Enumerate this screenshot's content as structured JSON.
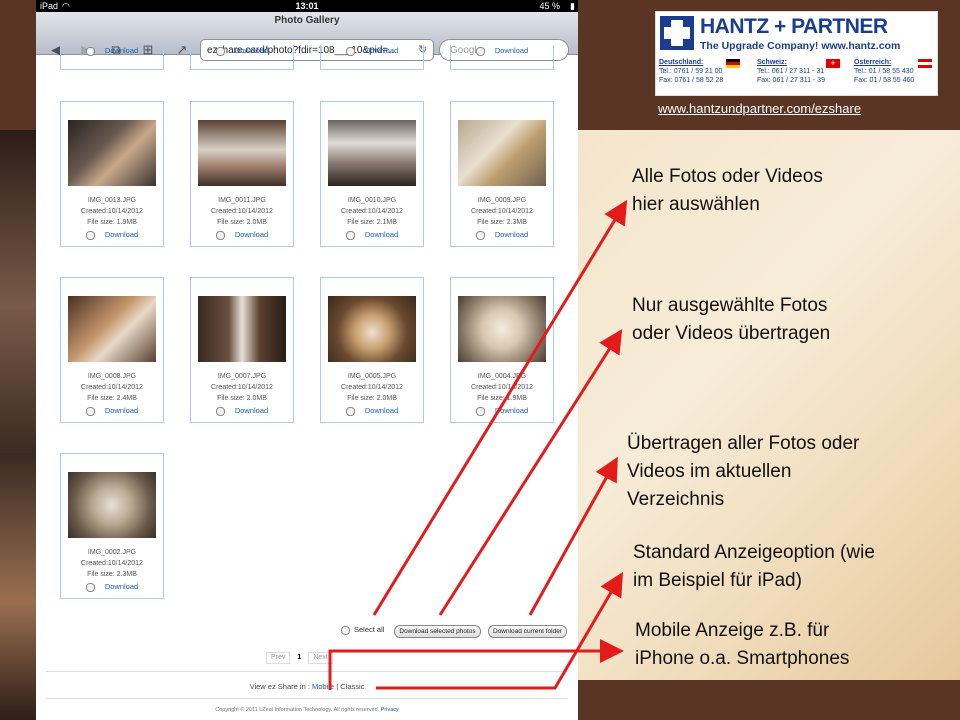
{
  "status": {
    "device": "iPad",
    "time": "13:01",
    "battery": "45 %"
  },
  "browser": {
    "page_title": "Photo Gallery",
    "url": "ezshare.card/photo?fdir=108___10&pid=...",
    "search_placeholder": "Google"
  },
  "gallery": {
    "download_label": "Download",
    "photos": [
      {
        "name": "IMG_0013.JPG",
        "created": "Created:10/14/2012",
        "size": "File size:   1.9MB"
      },
      {
        "name": "IMG_0011.JPG",
        "created": "Created:10/14/2012",
        "size": "File size:   2.0MB"
      },
      {
        "name": "IMG_0010.JPG",
        "created": "Created:10/14/2012",
        "size": "File size:   2.1MB"
      },
      {
        "name": "IMG_0009.JPG",
        "created": "Created:10/14/2012",
        "size": "File size:   2.3MB"
      },
      {
        "name": "IMG_0008.JPG",
        "created": "Created:10/14/2012",
        "size": "File size:   2.4MB"
      },
      {
        "name": "IMG_0007.JPG",
        "created": "Created:10/14/2012",
        "size": "File size:   2.0MB"
      },
      {
        "name": "IMG_0005.JPG",
        "created": "Created:10/14/2012",
        "size": "File size:   2.0MB"
      },
      {
        "name": "IMG_0004.JPG",
        "created": "Created:10/14/2012",
        "size": "File size:   1.9MB"
      },
      {
        "name": "IMG_0002.JPG",
        "created": "Created:10/14/2012",
        "size": "File size:   2.3MB"
      }
    ],
    "select_all": "Select all",
    "download_selected": "Download selected photos",
    "download_folder": "Download current folder",
    "pager": {
      "prev": "Prev",
      "current": "1",
      "next": "Next"
    },
    "view_in": "View ez Share in :",
    "mobile": "Mobile",
    "separator": "|",
    "classic": "Classic",
    "copyright": "Copyright © 2011 LZeal Information Technology. All rights reserved.",
    "privacy": "Privacy"
  },
  "logo": {
    "name": "HANTZ + PARTNER",
    "tagline": "The Upgrade Company! www.hantz.com",
    "columns": [
      {
        "country": "Deutschland:",
        "tel": "Tel.: 0761 / 59 21 00",
        "fax": "Fax: 0761 / 58 52 28"
      },
      {
        "country": "Schweiz:",
        "tel": "Tel.: 061 / 27 311 - 31",
        "fax": "Fax: 061 / 27 311 - 39"
      },
      {
        "country": "Österreich:",
        "tel": "Tel.: 01 / 58 55 430",
        "fax": "Fax: 01 / 58 55 460"
      }
    ]
  },
  "weblink": "www.hantzundpartner.com/ezshare",
  "annotations": [
    {
      "line1": "Alle Fotos oder Videos",
      "line2": "hier auswählen"
    },
    {
      "line1": "Nur ausgewählte Fotos",
      "line2": "oder Videos übertragen"
    },
    {
      "line1": "Übertragen aller Fotos oder",
      "line2": "Videos im aktuellen",
      "line3": "Verzeichnis"
    },
    {
      "line1": "Standard Anzeigeoption (wie",
      "line2": "im Beispiel für iPad)"
    },
    {
      "line1": "Mobile Anzeige z.B. für",
      "line2": "iPhone o.a. Smartphones"
    }
  ],
  "colors": {
    "arrow": "#e31b1b",
    "link": "#1a5fb4",
    "brand": "#1b3d8f",
    "card_border": "#a9cfe6"
  }
}
